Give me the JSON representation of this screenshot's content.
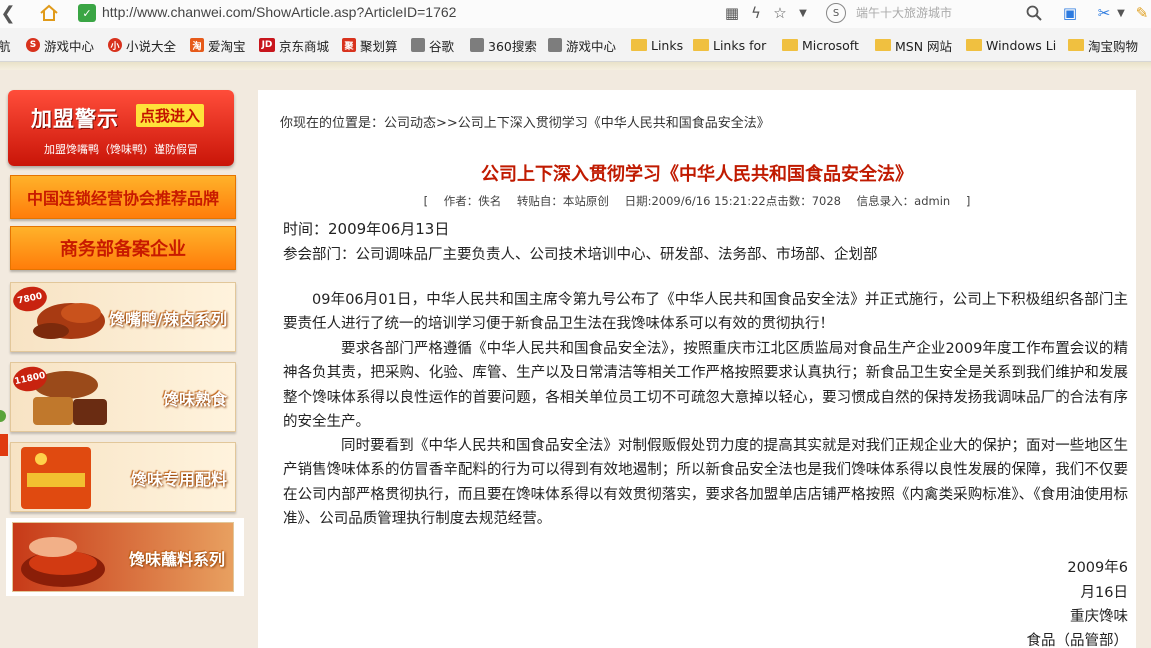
{
  "browser": {
    "url": "http://www.chanwei.com/ShowArticle.asp?ArticleID=1762",
    "search_placeholder": "端午十大旅游城市",
    "bookmarks": [
      {
        "label": "航",
        "icon": "none"
      },
      {
        "label": "游戏中心",
        "icon": "red-circle"
      },
      {
        "label": "小说大全",
        "icon": "red-square"
      },
      {
        "label": "爱淘宝",
        "icon": "orange"
      },
      {
        "label": "京东商城",
        "icon": "jd"
      },
      {
        "label": "聚划算",
        "icon": "red-square"
      },
      {
        "label": "谷歌",
        "icon": "grey"
      },
      {
        "label": "360搜索",
        "icon": "grey"
      },
      {
        "label": "游戏中心",
        "icon": "grey"
      },
      {
        "label": "Links",
        "icon": "folder"
      },
      {
        "label": "Links for",
        "icon": "folder"
      },
      {
        "label": "Microsoft",
        "icon": "folder"
      },
      {
        "label": "MSN 网站",
        "icon": "folder"
      },
      {
        "label": "Windows Li",
        "icon": "folder"
      },
      {
        "label": "淘宝购物",
        "icon": "folder"
      }
    ]
  },
  "sidebar": {
    "alliance_title": "加盟警示",
    "alliance_enter": "点我进入",
    "alliance_sub": "加盟馋嘴鸭（馋味鸭）谨防假冒",
    "chain_label": "中国连锁经营协会推荐品牌",
    "commerce_label": "商务部备案企业",
    "cards": [
      {
        "price": "7800",
        "label": "馋嘴鸭/辣卤系列"
      },
      {
        "price": "11800",
        "label": "馋味熟食"
      },
      {
        "price": "",
        "label": "馋味专用配料"
      },
      {
        "price": "",
        "label": "馋味蘸料系列"
      }
    ]
  },
  "article": {
    "breadcrumb": "你现在的位置是：公司动态>>公司上下深入贯彻学习《中华人民共和国食品安全法》",
    "title": "公司上下深入贯彻学习《中华人民共和国食品安全法》",
    "meta": {
      "open": "[",
      "author": "作者：佚名",
      "source": "转贴自：本站原创",
      "date": "日期:2009/6/16 15:21:22",
      "views": "点击数：7028",
      "editor": "信息录入：admin",
      "close": "]"
    },
    "time_line": "时间：2009年06月13日",
    "dept_line": "参会部门：公司调味品厂主要负责人、公司技术培训中心、研发部、法务部、市场部、企划部",
    "paragraphs": [
      "09年06月01日，中华人民共和国主席令第九号公布了《中华人民共和国食品安全法》并正式施行，公司上下积极组织各部门主要责任人进行了统一的培训学习便于新食品卫生法在我馋味体系可以有效的贯彻执行！",
      "要求各部门严格遵循《中华人民共和国食品安全法》，按照重庆市江北区质监局对食品生产企业2009年度工作布置会议的精神各负其责，把采购、化验、库管、生产以及日常清洁等相关工作严格按照要求认真执行；新食品卫生安全是关系到我们维护和发展整个馋味体系得以良性运作的首要问题，各相关单位员工切不可疏忽大意掉以轻心，要习惯成自然的保持发扬我调味品厂的合法有序的安全生产。",
      "同时要看到《中华人民共和国食品安全法》对制假贩假处罚力度的提高其实就是对我们正规企业大的保护；面对一些地区生产销售馋味体系的仿冒香辛配料的行为可以得到有效地遏制；所以新食品安全法也是我们馋味体系得以良性发展的保障，我们不仅要在公司内部严格贯彻执行，而且要在馋味体系得以有效贯彻落实，要求各加盟单店店铺严格按照《内禽类采购标准》、《食用油使用标准》、公司品质管理执行制度去规范经营。"
    ],
    "signature": [
      "2009年6",
      "月16日",
      "重庆馋味",
      "食品（品管部）"
    ]
  }
}
